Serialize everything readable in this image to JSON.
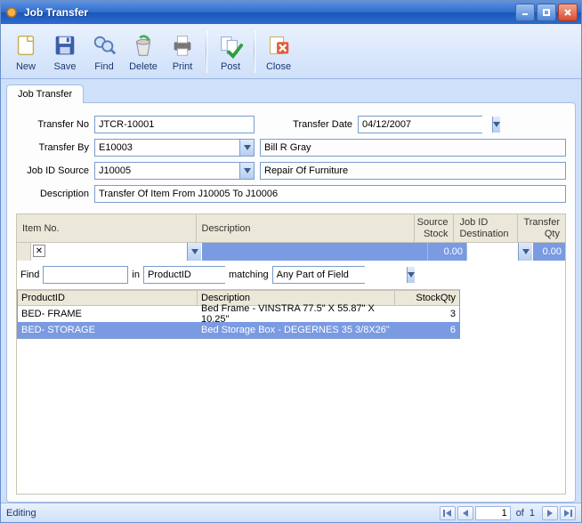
{
  "window": {
    "title": "Job Transfer"
  },
  "toolbar": {
    "new": "New",
    "save": "Save",
    "find": "Find",
    "delete": "Delete",
    "print": "Print",
    "post": "Post",
    "close": "Close"
  },
  "tabs": {
    "main": "Job Transfer"
  },
  "form": {
    "transfer_no_label": "Transfer No",
    "transfer_no": "JTCR-10001",
    "transfer_date_label": "Transfer Date",
    "transfer_date": "04/12/2007",
    "transfer_by_label": "Transfer By",
    "transfer_by_code": "E10003",
    "transfer_by_name": "Bill R Gray",
    "job_source_label": "Job ID Source",
    "job_source_code": "J10005",
    "job_source_name": "Repair Of Furniture",
    "description_label": "Description",
    "description": "Transfer Of Item From J10005 To J10006"
  },
  "grid": {
    "headers": {
      "item": "Item No.",
      "desc": "Description",
      "src1": "Source",
      "src2": "Stock",
      "dest1": "Job ID",
      "dest2": "Destination",
      "qty1": "Transfer",
      "qty2": "Qty"
    },
    "row": {
      "src_stock": "0.00",
      "qty": "0.00"
    }
  },
  "findbar": {
    "find_label": "Find",
    "in_label": "in",
    "matching_label": "matching",
    "field": "ProductID",
    "mode": "Any Part of Field"
  },
  "lookup": {
    "headers": {
      "pid": "ProductID",
      "desc": "Description",
      "stock": "StockQty"
    },
    "rows": [
      {
        "pid": "BED- FRAME",
        "desc": "Bed Frame - VINSTRA 77.5\" X 55.87\" X 10.25\"",
        "stock": "3"
      },
      {
        "pid": "BED- STORAGE",
        "desc": "Bed Storage Box - DEGERNES 35 3/8X26\"",
        "stock": "6"
      }
    ]
  },
  "status": {
    "mode": "Editing",
    "of_label": "of",
    "current": "1",
    "total": "1"
  }
}
